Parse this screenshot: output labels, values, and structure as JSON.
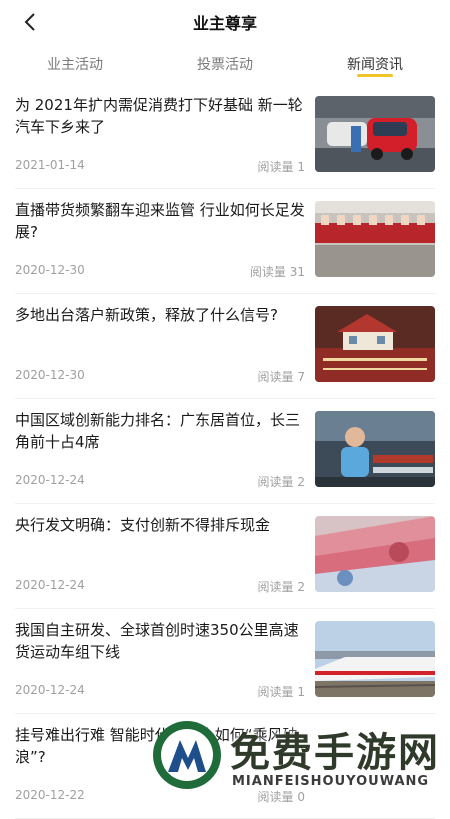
{
  "header": {
    "title": "业主尊享"
  },
  "tabs": [
    {
      "label": "业主活动"
    },
    {
      "label": "投票活动"
    },
    {
      "label": "新闻资讯"
    }
  ],
  "news": [
    {
      "title": "为 2021年扩内需促消费打下好基础 新一轮汽车下乡来了",
      "date": "2021-01-14",
      "reads": "阅读量 1",
      "thumb": "car-factory-image"
    },
    {
      "title": "直播带货频繁翻车迎来监管 行业如何长足发展?",
      "date": "2020-12-30",
      "reads": "阅读量 31",
      "thumb": "livestream-image"
    },
    {
      "title": "多地出台落户新政策，释放了什么信号?",
      "date": "2020-12-30",
      "reads": "阅读量 7",
      "thumb": "household-register-image"
    },
    {
      "title": "中国区域创新能力排名：广东居首位，长三角前十占4席",
      "date": "2020-12-24",
      "reads": "阅读量 2",
      "thumb": "factory-worker-image"
    },
    {
      "title": "央行发文明确：支付创新不得排斥现金",
      "date": "2020-12-24",
      "reads": "阅读量 2",
      "thumb": "cash-image"
    },
    {
      "title": "我国自主研发、全球首创时速350公里高速货运动车组下线",
      "date": "2020-12-24",
      "reads": "阅读量 1",
      "thumb": "train-image"
    },
    {
      "title": "挂号难出行难 智能时代老年人如何“乘风破浪”?",
      "date": "2020-12-22",
      "reads": "阅读量 0",
      "thumb": ""
    }
  ],
  "watermark": {
    "cn": "免费手游网",
    "en": "MIANFEISHOUYOUWANG"
  },
  "colors": {
    "accent": "#f3c428",
    "muted": "#a0a0a0"
  }
}
